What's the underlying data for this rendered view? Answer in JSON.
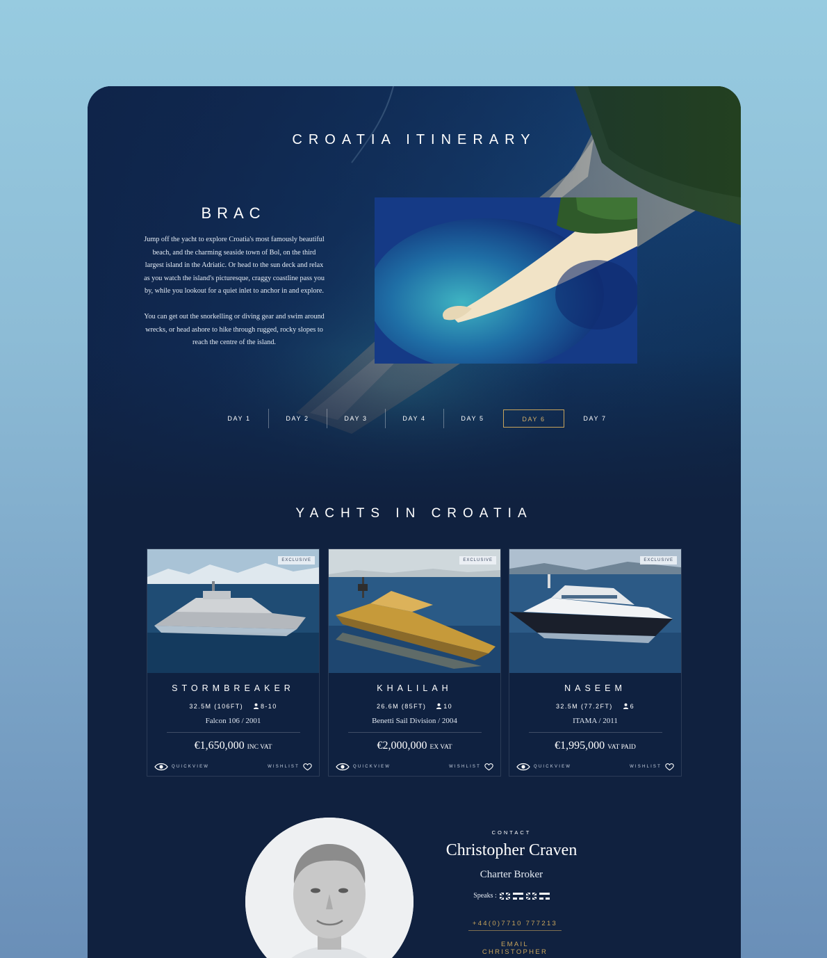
{
  "hero": {
    "title": "CROATIA ITINERARY",
    "place": "BRAC",
    "desc_p1": "Jump off the yacht to explore Croatia's most famously beautiful beach, and the charming seaside town of Bol, on the third largest island in the Adriatic. Or head to the sun deck and relax as you watch the island's picturesque, craggy coastline pass you by, while you lookout for a quiet inlet to anchor in and explore.",
    "desc_p2": "You can get out the snorkelling or diving gear and swim around wrecks, or head ashore to hike through rugged, rocky slopes to reach the centre of the island."
  },
  "days": [
    {
      "label": "DAY 1"
    },
    {
      "label": "DAY 2"
    },
    {
      "label": "DAY 3"
    },
    {
      "label": "DAY 4"
    },
    {
      "label": "DAY 5"
    },
    {
      "label": "DAY 6"
    },
    {
      "label": "DAY 7"
    }
  ],
  "active_day": "DAY 6",
  "yachts_title": "YACHTS IN CROATIA",
  "yachts": [
    {
      "badge": "EXCLUSIVE",
      "name": "STORMBREAKER",
      "size": "32.5M (106FT)",
      "guests": "8-10",
      "model": "Falcon 106 / 2001",
      "price": "€1,650,000",
      "vat": "INC VAT",
      "quickview": "QUICKVIEW",
      "wishlist": "WISHLIST"
    },
    {
      "badge": "EXCLUSIVE",
      "name": "KHALILAH",
      "size": "26.6M (85FT)",
      "guests": "10",
      "model": "Benetti Sail Division / 2004",
      "price": "€2,000,000",
      "vat": "EX VAT",
      "quickview": "QUICKVIEW",
      "wishlist": "WISHLIST"
    },
    {
      "badge": "EXCLUSIVE",
      "name": "NASEEM",
      "size": "32.5M (77.2FT)",
      "guests": "6",
      "model": "ITAMA / 2011",
      "price": "€1,995,000",
      "vat": "VAT PAID",
      "quickview": "QUICKVIEW",
      "wishlist": "WISHLIST"
    }
  ],
  "contact": {
    "label": "CONTACT",
    "name": "Christopher Craven",
    "role": "Charter Broker",
    "speaks": "Speaks :",
    "phone": "+44(0)7710 777213",
    "email": "EMAIL CHRISTOPHER"
  },
  "colors": {
    "navy": "#10213f",
    "gold": "#c9a55c",
    "sky": "#97cbe0"
  }
}
